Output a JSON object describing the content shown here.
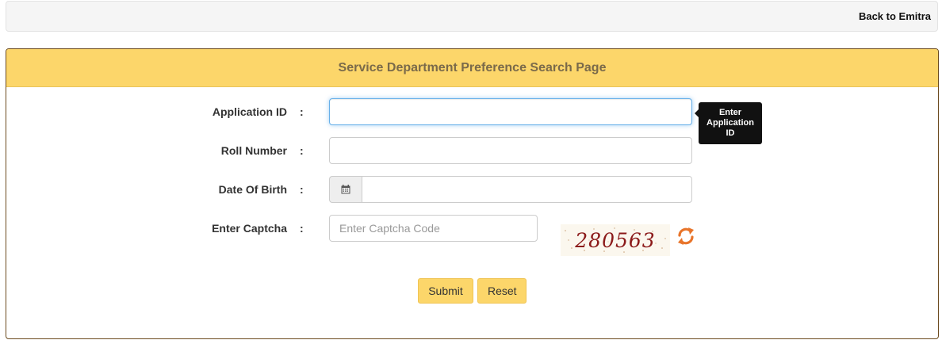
{
  "topbar": {
    "back_link": "Back to Emitra"
  },
  "panel": {
    "title": "Service Department Preference Search Page"
  },
  "form": {
    "colon": ":",
    "application_id": {
      "label": "Application ID",
      "value": "",
      "placeholder": ""
    },
    "roll_number": {
      "label": "Roll Number",
      "value": "",
      "placeholder": ""
    },
    "date_of_birth": {
      "label": "Date Of Birth",
      "value": "",
      "placeholder": "",
      "icon": "calendar-icon"
    },
    "captcha": {
      "label": "Enter Captcha",
      "value": "",
      "placeholder": "Enter Captcha Code",
      "image_text": "280563",
      "refresh_icon": "refresh-icon"
    }
  },
  "tooltip": {
    "text": "Enter Application ID"
  },
  "buttons": {
    "submit": "Submit",
    "reset": "Reset"
  },
  "colors": {
    "panel_header": "#fcd66a",
    "panel_border": "#6b4a1e",
    "refresh": "#e8742a",
    "captcha_text": "#8b1a1a"
  }
}
